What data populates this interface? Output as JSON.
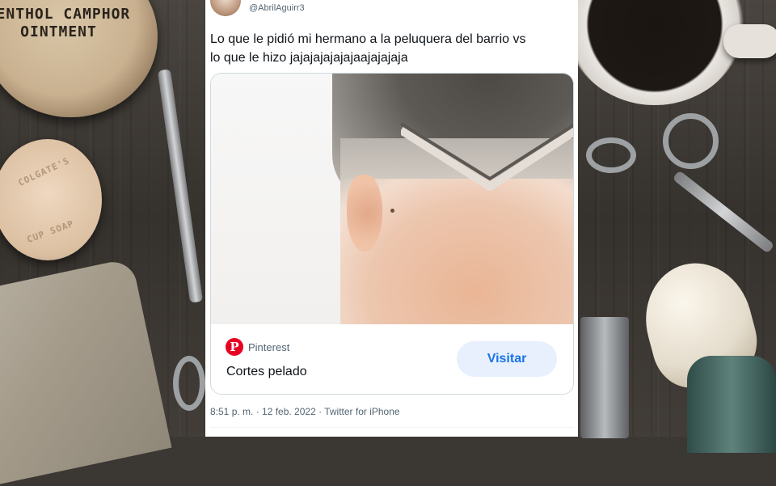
{
  "background": {
    "tin_label_line1": "MENTHOL CAMPHOR",
    "tin_label_line2": "OINTMENT",
    "soap_label_line1": "COLGATE'S",
    "soap_label_line2": "CUP SOAP"
  },
  "tweet": {
    "handle": "@AbrilAguirr3",
    "text_line1": "Lo que le pidió mi hermano a la peluquera del barrio vs",
    "text_line2": "lo que le hizo jajajajajajajaajajajaja",
    "card": {
      "source_icon": "pinterest-icon",
      "source": "Pinterest",
      "title": "Cortes pelado",
      "visit_label": "Visitar"
    },
    "meta": "8:51 p. m. · 12 feb. 2022 · Twitter for iPhone"
  },
  "colors": {
    "pinterest_red": "#e60023",
    "button_blue_text": "#1a73e8",
    "button_blue_bg": "#e8f0fe",
    "muted_text": "#536471"
  }
}
